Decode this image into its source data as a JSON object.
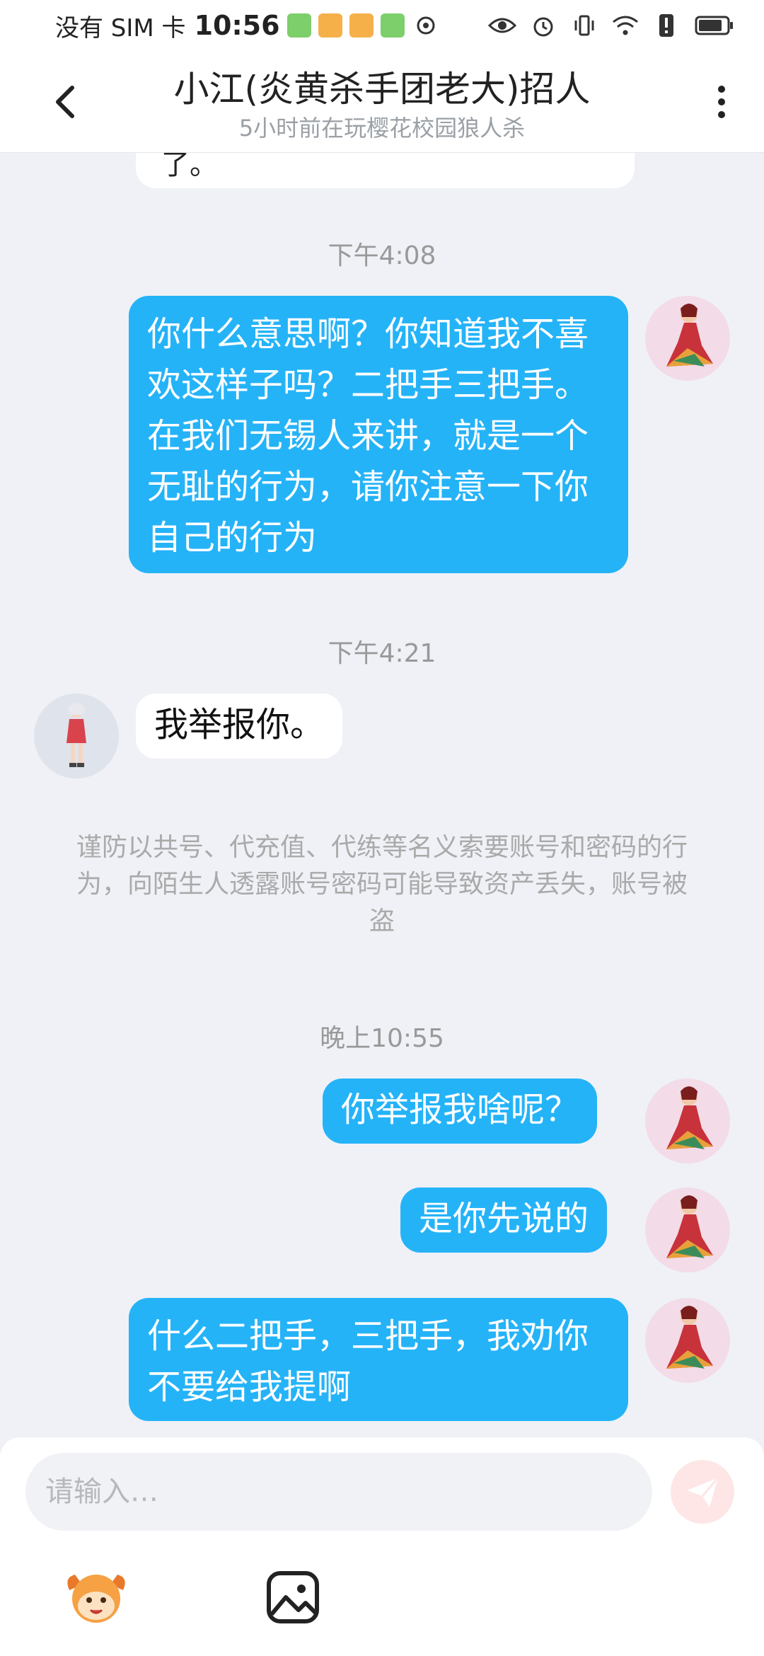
{
  "status_bar": {
    "carrier": "没有 SIM 卡",
    "time": "10:56"
  },
  "header": {
    "title": "小江(炎黄杀手团老大)招人",
    "subtitle": "5小时前在玩樱花校园狼人杀"
  },
  "chat": {
    "partial_text": "了。",
    "timestamps": {
      "t1": "下午4:08",
      "t2": "下午4:21",
      "t3": "晚上10:55"
    },
    "messages": {
      "m1": {
        "sender": "me",
        "text": "你什么意思啊？你知道我不喜欢这样子吗？二把手三把手。在我们无锡人来讲，就是一个无耻的行为，请你注意一下你自己的行为"
      },
      "m2": {
        "sender": "other",
        "text": "我举报你。"
      },
      "m3": {
        "sender": "me",
        "text": "你举报我啥呢？"
      },
      "m4": {
        "sender": "me",
        "text": "是你先说的"
      },
      "m5": {
        "sender": "me",
        "text": "什么二把手，三把手，我劝你不要给我提啊"
      }
    },
    "warning": "谨防以共号、代充值、代练等名义索要账号和密码的行为，向陌生人透露账号密码可能导致资产丢失，账号被盗"
  },
  "composer": {
    "placeholder": "请输入…",
    "send_icon": "paper-plane-icon",
    "tools": [
      "mascot-emoji-icon",
      "image-icon"
    ]
  },
  "colors": {
    "my_bubble": "#25b3f8",
    "other_bubble": "#ffffff",
    "background": "#eff1f6",
    "send_disabled": "#fde6e5"
  }
}
